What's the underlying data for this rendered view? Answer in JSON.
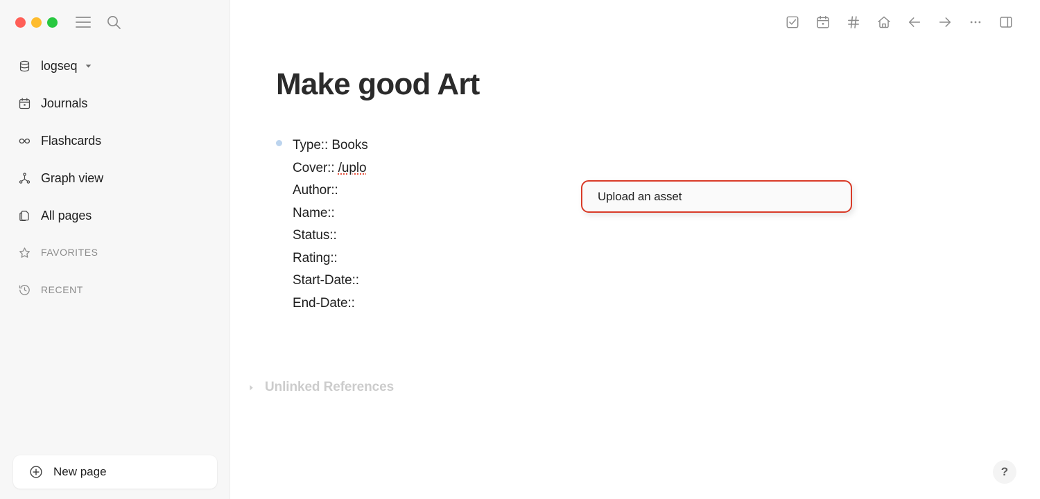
{
  "window": {
    "traffic_lights": [
      {
        "name": "close",
        "color": "#ff5f57"
      },
      {
        "name": "minimize",
        "color": "#febc2e"
      },
      {
        "name": "maximize",
        "color": "#28c840"
      }
    ],
    "menu_icon": "hamburger-menu-icon",
    "search_icon": "search-icon"
  },
  "sidebar": {
    "graph": {
      "label": "logseq",
      "icon": "database-icon",
      "chevron": "chevron-down-icon"
    },
    "items": [
      {
        "label": "Journals",
        "icon": "calendar-icon"
      },
      {
        "label": "Flashcards",
        "icon": "infinity-icon"
      },
      {
        "label": "Graph view",
        "icon": "graph-icon"
      },
      {
        "label": "All pages",
        "icon": "pages-icon"
      }
    ],
    "sections": [
      {
        "label": "FAVORITES",
        "icon": "star-icon"
      },
      {
        "label": "RECENT",
        "icon": "clock-history-icon"
      }
    ],
    "new_page": {
      "label": "New page",
      "icon": "plus-circle-icon"
    }
  },
  "toolbar": {
    "buttons": [
      {
        "name": "todo-icon",
        "title": "Todo"
      },
      {
        "name": "calendar-icon",
        "title": "Calendar"
      },
      {
        "name": "hash-icon",
        "title": "Tags"
      },
      {
        "name": "home-icon",
        "title": "Home"
      },
      {
        "name": "arrow-left-icon",
        "title": "Back"
      },
      {
        "name": "arrow-right-icon",
        "title": "Forward"
      },
      {
        "name": "ellipsis-icon",
        "title": "More"
      },
      {
        "name": "right-sidebar-icon",
        "title": "Toggle right sidebar"
      }
    ]
  },
  "page": {
    "title": "Make good Art",
    "properties": [
      {
        "key": "Type::",
        "value": "Books",
        "misspelled": false
      },
      {
        "key": "Cover::",
        "value": "/uplo",
        "misspelled": true
      },
      {
        "key": "Author::",
        "value": "",
        "misspelled": false
      },
      {
        "key": "Name::",
        "value": "",
        "misspelled": false
      },
      {
        "key": "Status::",
        "value": "",
        "misspelled": false
      },
      {
        "key": "Rating::",
        "value": "",
        "misspelled": false
      },
      {
        "key": "Start-Date::",
        "value": "",
        "misspelled": false
      },
      {
        "key": "End-Date::",
        "value": "",
        "misspelled": false
      }
    ],
    "unlinked_references": {
      "label": "Unlinked References",
      "expanded": false,
      "triangle_icon": "triangle-right-icon"
    }
  },
  "autocomplete_popup": {
    "item_label": "Upload an asset",
    "border_color": "#d93b28",
    "background": "#fafafa"
  },
  "help": {
    "label": "?",
    "icon": "question-mark-icon"
  },
  "colors": {
    "sidebar_bg": "#f7f7f7",
    "main_bg": "#ffffff",
    "text": "#1f1f1f",
    "muted": "#8b8b8b",
    "bullet": "#bcd4ee",
    "accent_red": "#d93b28"
  }
}
